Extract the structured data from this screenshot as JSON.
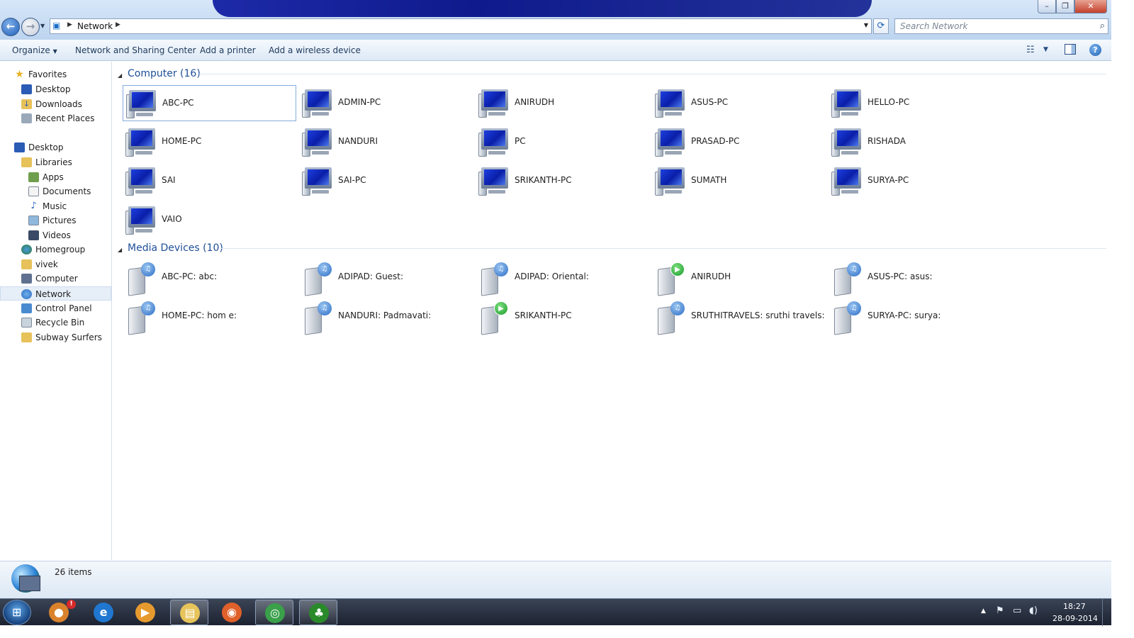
{
  "window": {
    "controls": {
      "minimize": "–",
      "maximize": "❐",
      "close": "✕"
    }
  },
  "address": {
    "crumb": "Network",
    "search_placeholder": "Search Network"
  },
  "commands": {
    "organize": "Organize",
    "network_sharing_center": "Network and Sharing Center",
    "add_printer": "Add a printer",
    "add_wireless": "Add a wireless device"
  },
  "sidebar": {
    "favorites": "Favorites",
    "desktop_fav": "Desktop",
    "downloads": "Downloads",
    "recent_places": "Recent Places",
    "desktop": "Desktop",
    "libraries": "Libraries",
    "apps": "Apps",
    "documents": "Documents",
    "music": "Music",
    "pictures": "Pictures",
    "videos": "Videos",
    "homegroup": "Homegroup",
    "vivek": "vivek",
    "computer": "Computer",
    "network": "Network",
    "control_panel": "Control Panel",
    "recycle_bin": "Recycle Bin",
    "subway_surfers": "Subway Surfers"
  },
  "groups": {
    "computer_header": "Computer (16)",
    "media_header": "Media Devices (10)"
  },
  "computers": [
    "ABC-PC",
    "ADMIN-PC",
    "ANIRUDH",
    "ASUS-PC",
    "HELLO-PC",
    "HOME-PC",
    "NANDURI",
    "PC",
    "PRASAD-PC",
    "RISHADA",
    "SAI",
    "SAI-PC",
    "SRIKANTH-PC",
    "SUMATH",
    "SURYA-PC",
    "VAIO"
  ],
  "media_devices": [
    {
      "name": "ABC-PC: abc:",
      "badge": "media"
    },
    {
      "name": "ADIPAD: Guest:",
      "badge": "media"
    },
    {
      "name": "ADIPAD: Oriental:",
      "badge": "media"
    },
    {
      "name": "ANIRUDH",
      "badge": "play"
    },
    {
      "name": "ASUS-PC: asus:",
      "badge": "media"
    },
    {
      "name": "HOME-PC: hom e:",
      "badge": "media"
    },
    {
      "name": "NANDURI: Padmavati:",
      "badge": "media"
    },
    {
      "name": "SRIKANTH-PC",
      "badge": "play"
    },
    {
      "name": "SRUTHITRAVELS: sruthi travels:",
      "badge": "media"
    },
    {
      "name": "SURYA-PC: surya:",
      "badge": "media"
    }
  ],
  "details": {
    "item_count": "26 items"
  },
  "taskbar": {
    "clock_time": "18:27",
    "clock_date": "28-09-2014",
    "pinned": [
      {
        "name": "chrome-badge-icon",
        "color": "#d9822b",
        "active": false
      },
      {
        "name": "internet-explorer-icon",
        "color": "#1f77d0",
        "active": false
      },
      {
        "name": "media-player-icon",
        "color": "#e69a2e",
        "active": false
      },
      {
        "name": "file-explorer-icon",
        "color": "#e6c45a",
        "active": true
      },
      {
        "name": "firefox-icon",
        "color": "#e0602a",
        "active": false
      },
      {
        "name": "chrome-icon",
        "color": "#3aa04a",
        "active": true
      },
      {
        "name": "tree-app-icon",
        "color": "#2a8a2a",
        "active": true
      }
    ]
  }
}
